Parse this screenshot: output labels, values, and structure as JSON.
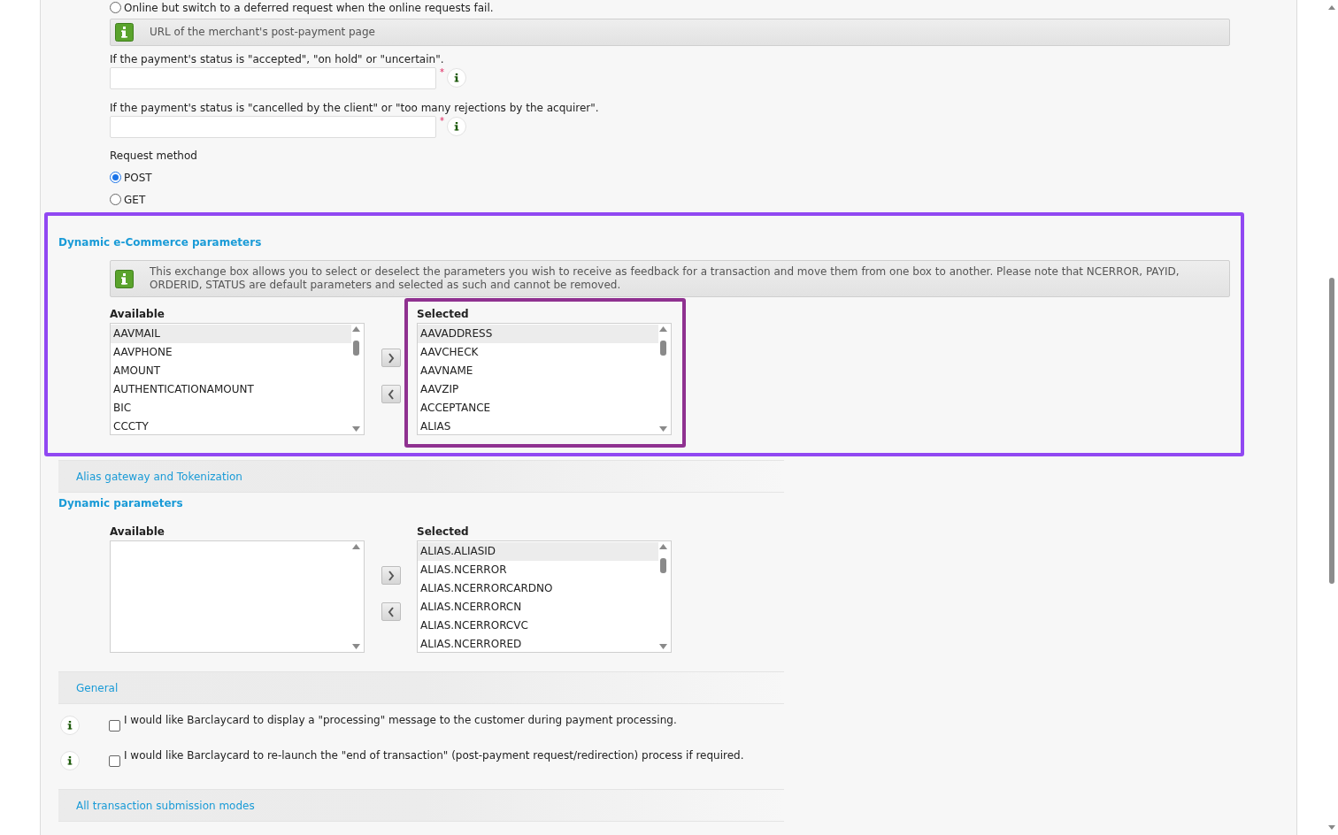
{
  "submission_options": [
    {
      "label": "Online but switch to a deferred request when the online requests fail.",
      "selected": false
    }
  ],
  "post_payment": {
    "info": "URL of the merchant's post-payment page",
    "fields": [
      {
        "label": "If the payment's status is \"accepted\", \"on hold\" or \"uncertain\".",
        "required_mark": "*"
      },
      {
        "label": "If the payment's status is \"cancelled by the client\" or \"too many rejections by the acquirer\".",
        "required_mark": "*"
      }
    ]
  },
  "request_method": {
    "label": "Request method",
    "options": [
      {
        "label": "POST",
        "selected": true
      },
      {
        "label": "GET",
        "selected": false
      }
    ]
  },
  "ecommerce_parameters": {
    "title": "Dynamic e-Commerce parameters",
    "info": "This exchange box allows you to select or deselect the parameters you wish to receive as feedback for a transaction and move them from one box to another. Please note that NCERROR, PAYID, ORDERID, STATUS are default parameters and selected as such and cannot be removed.",
    "available": {
      "label": "Available",
      "items": [
        {
          "label": "AAVMAIL",
          "selected": true
        },
        {
          "label": "AAVPHONE",
          "selected": false
        },
        {
          "label": "AMOUNT",
          "selected": false
        },
        {
          "label": "AUTHENTICATIONAMOUNT",
          "selected": false
        },
        {
          "label": "BIC",
          "selected": false
        },
        {
          "label": "CCCTY",
          "selected": false
        }
      ]
    },
    "selected": {
      "label": "Selected",
      "items": [
        {
          "label": "AAVADDRESS",
          "selected": true
        },
        {
          "label": "AAVCHECK",
          "selected": false
        },
        {
          "label": "AAVNAME",
          "selected": false
        },
        {
          "label": "AAVZIP",
          "selected": false
        },
        {
          "label": "ACCEPTANCE",
          "selected": false
        },
        {
          "label": "ALIAS",
          "selected": false
        }
      ]
    }
  },
  "alias_section": {
    "title": "Alias gateway and Tokenization"
  },
  "dynamic_parameters": {
    "title": "Dynamic parameters",
    "available": {
      "label": "Available"
    },
    "selected": {
      "label": "Selected",
      "items": [
        {
          "label": "ALIAS.ALIASID",
          "selected": true
        },
        {
          "label": "ALIAS.NCERROR",
          "selected": false
        },
        {
          "label": "ALIAS.NCERRORCARDNO",
          "selected": false
        },
        {
          "label": "ALIAS.NCERRORCN",
          "selected": false
        },
        {
          "label": "ALIAS.NCERRORCVC",
          "selected": false
        },
        {
          "label": "ALIAS.NCERRORED",
          "selected": false
        }
      ]
    }
  },
  "general": {
    "title": "General",
    "options": [
      {
        "label": "I would like Barclaycard to display a \"processing\" message to the customer during payment processing.",
        "checked": false
      },
      {
        "label": "I would like Barclaycard to re-launch the \"end of transaction\" (post-payment request/redirection) process if required.",
        "checked": false
      }
    ]
  },
  "next_section": {
    "title": "All transaction submission modes"
  }
}
